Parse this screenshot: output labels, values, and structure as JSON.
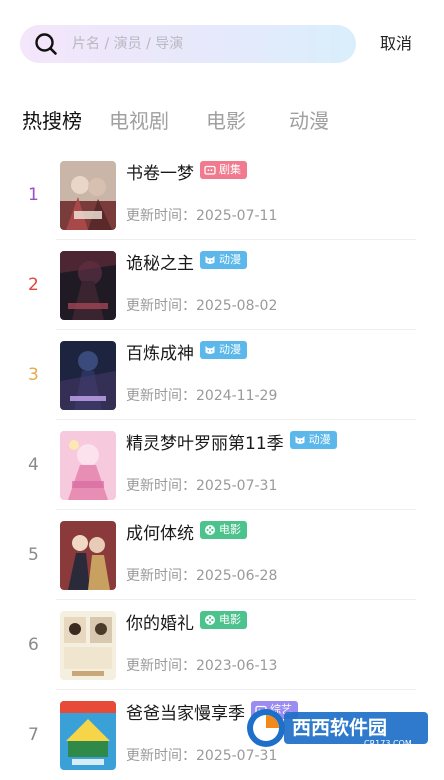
{
  "search": {
    "placeholder": "片名 / 演员 / 导演",
    "cancel_label": "取消"
  },
  "tabs": [
    {
      "label": "热搜榜",
      "active": true
    },
    {
      "label": "电视剧",
      "active": false
    },
    {
      "label": "电影",
      "active": false
    },
    {
      "label": "动漫",
      "active": false
    }
  ],
  "date_prefix": "更新时间：",
  "items": [
    {
      "rank": "1",
      "rank_color": "#9b4fc4",
      "title": "书卷一梦",
      "badge": "剧集",
      "badge_color": "#f07b8e",
      "badge_icon": "tv-icon",
      "date": "2025-07-11"
    },
    {
      "rank": "2",
      "rank_color": "#e0483a",
      "title": "诡秘之主",
      "badge": "动漫",
      "badge_color": "#5cb8ea",
      "badge_icon": "cat-face-icon",
      "date": "2025-08-02"
    },
    {
      "rank": "3",
      "rank_color": "#e8a94a",
      "title": "百炼成神",
      "badge": "动漫",
      "badge_color": "#5cb8ea",
      "badge_icon": "cat-face-icon",
      "date": "2024-11-29"
    },
    {
      "rank": "4",
      "rank_color": "#8a8a8a",
      "title": "精灵梦叶罗丽第11季",
      "badge": "动漫",
      "badge_color": "#5cb8ea",
      "badge_icon": "cat-face-icon",
      "date": "2025-07-31"
    },
    {
      "rank": "5",
      "rank_color": "#8a8a8a",
      "title": "成何体统",
      "badge": "电影",
      "badge_color": "#4cc28c",
      "badge_icon": "film-reel-icon",
      "date": "2025-06-28"
    },
    {
      "rank": "6",
      "rank_color": "#8a8a8a",
      "title": "你的婚礼",
      "badge": "电影",
      "badge_color": "#4cc28c",
      "badge_icon": "film-reel-icon",
      "date": "2023-06-13"
    },
    {
      "rank": "7",
      "rank_color": "#8a8a8a",
      "title": "爸爸当家慢享季",
      "badge": "综艺",
      "badge_color": "#9a8cf0",
      "badge_icon": "tv-icon",
      "date": "2025-07-31"
    }
  ],
  "watermark": {
    "logo_text": "西西软件园",
    "sub_text": "CR173.COM"
  }
}
